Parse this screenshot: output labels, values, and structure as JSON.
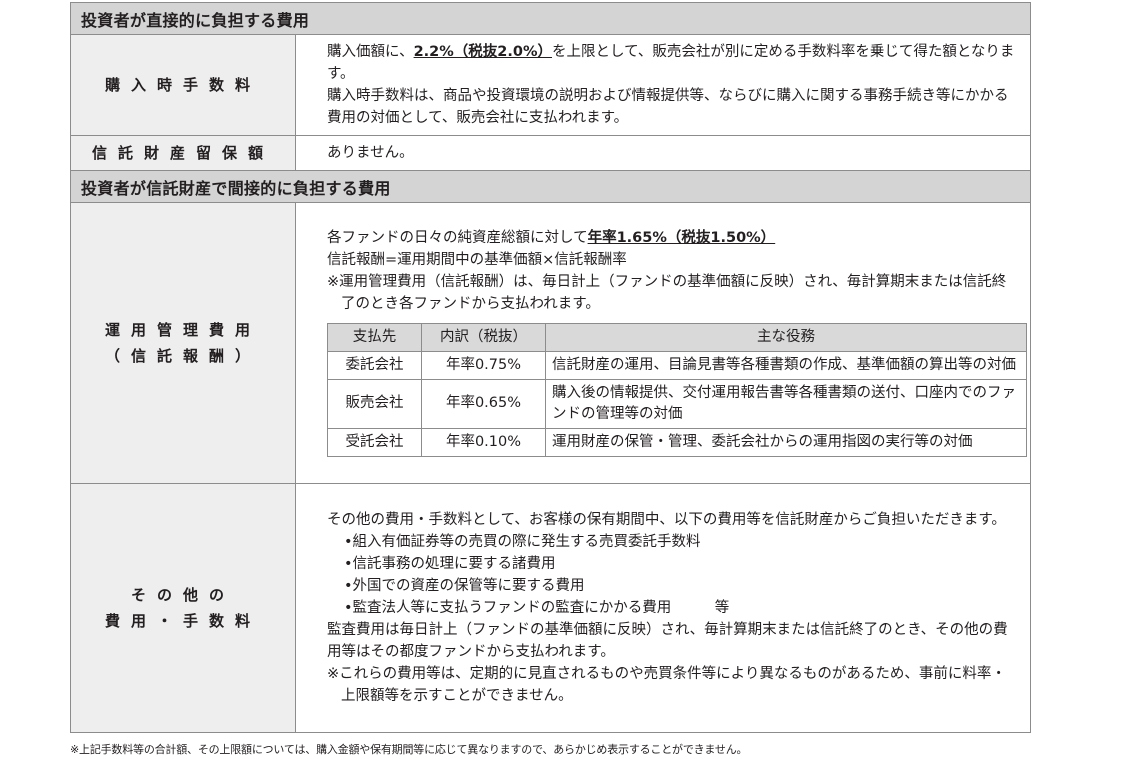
{
  "sections": {
    "direct_title": "投資者が直接的に負担する費用",
    "indirect_title": "投資者が信託財産で間接的に負担する費用"
  },
  "purchase_fee": {
    "label": "購入時手数料",
    "line1_pre": "購入価額に、",
    "line1_rate": "2.2%（税抜2.0%）",
    "line1_post": "を上限として、販売会社が別に定める手数料率を乗じて得た額となります。",
    "line2": "購入時手数料は、商品や投資環境の説明および情報提供等、ならびに購入に関する事務手続き等にかかる費用の対価として、販売会社に支払われます。"
  },
  "trust_reserve": {
    "label": "信託財産留保額",
    "text": "ありません。"
  },
  "management_fee": {
    "label_line1": "運用管理費用",
    "label_line2": "（信託報酬）",
    "line1_pre": "各ファンドの日々の純資産総額に対して",
    "line1_rate": "年率1.65%（税抜1.50%）",
    "line2": "信託報酬=運用期間中の基準価額×信託報酬率",
    "note": "※運用管理費用（信託報酬）は、毎日計上（ファンドの基準価額に反映）され、毎計算期末または信託終了のとき各ファンドから支払われます。",
    "table": {
      "headers": [
        "支払先",
        "内訳（税抜）",
        "主な役務"
      ],
      "rows": [
        [
          "委託会社",
          "年率0.75%",
          "信託財産の運用、目論見書等各種書類の作成、基準価額の算出等の対価"
        ],
        [
          "販売会社",
          "年率0.65%",
          "購入後の情報提供、交付運用報告書等各種書類の送付、口座内でのファンドの管理等の対価"
        ],
        [
          "受託会社",
          "年率0.10%",
          "運用財産の保管・管理、委託会社からの運用指図の実行等の対価"
        ]
      ]
    }
  },
  "other_fees": {
    "label_line1": "その他の",
    "label_line2": "費用・手数料",
    "intro": "その他の費用・手数料として、お客様の保有期間中、以下の費用等を信託財産からご負担いただきます。",
    "bullets": [
      "•組入有価証券等の売買の際に発生する売買委託手数料",
      "•信託事務の処理に要する諸費用",
      "•外国での資産の保管等に要する費用",
      "•監査法人等に支払うファンドの監査にかかる費用　　　等"
    ],
    "audit_note": "監査費用は毎日計上（ファンドの基準価額に反映）され、毎計算期末または信託終了のとき、その他の費用等はその都度ファンドから支払われます。",
    "disclaimer": "※これらの費用等は、定期的に見直されるものや売買条件等により異なるものがあるため、事前に料率・上限額等を示すことができません。"
  },
  "footnote": "※上記手数料等の合計額、その上限額については、購入金額や保有期間等に応じて異なりますので、あらかじめ表示することができません。"
}
